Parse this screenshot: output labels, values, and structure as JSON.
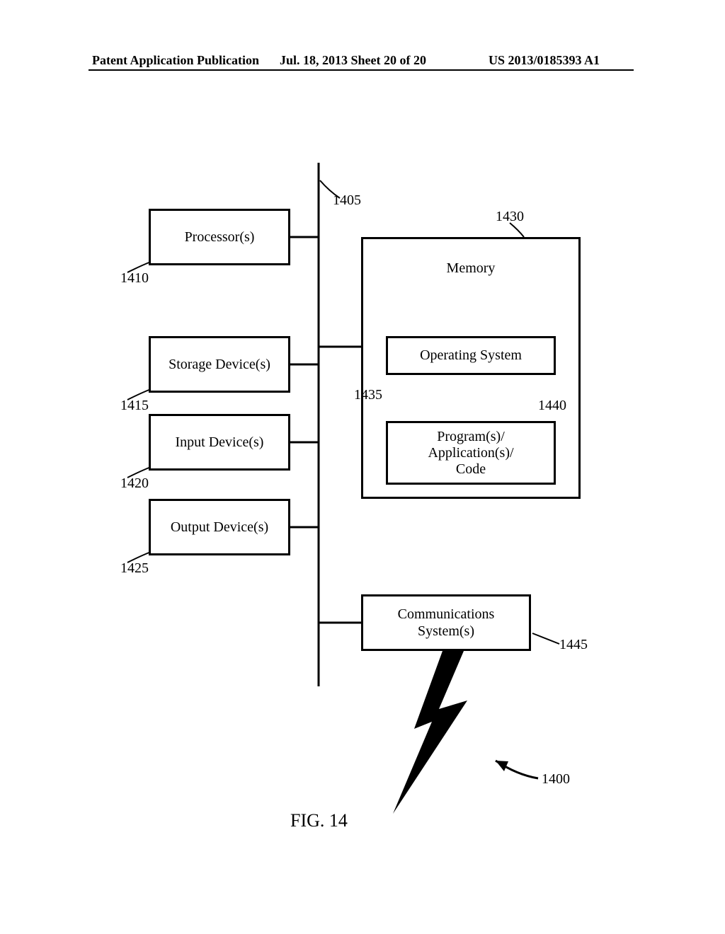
{
  "header": {
    "left": "Patent Application Publication",
    "center": "Jul. 18, 2013  Sheet 20 of 20",
    "right": "US 2013/0185393 A1"
  },
  "boxes": {
    "processor": "Processor(s)",
    "storage": "Storage Device(s)",
    "input": "Input Device(s)",
    "output": "Output Device(s)",
    "memory": "Memory",
    "os": "Operating System",
    "apps": "Program(s)/\nApplication(s)/\nCode",
    "comm": "Communications\nSystem(s)"
  },
  "labels": {
    "bus": "1405",
    "processor": "1410",
    "storage": "1415",
    "input": "1420",
    "output": "1425",
    "memory": "1430",
    "os": "1435",
    "apps": "1440",
    "comm": "1445",
    "figure": "1400"
  },
  "caption": "FIG. 14"
}
